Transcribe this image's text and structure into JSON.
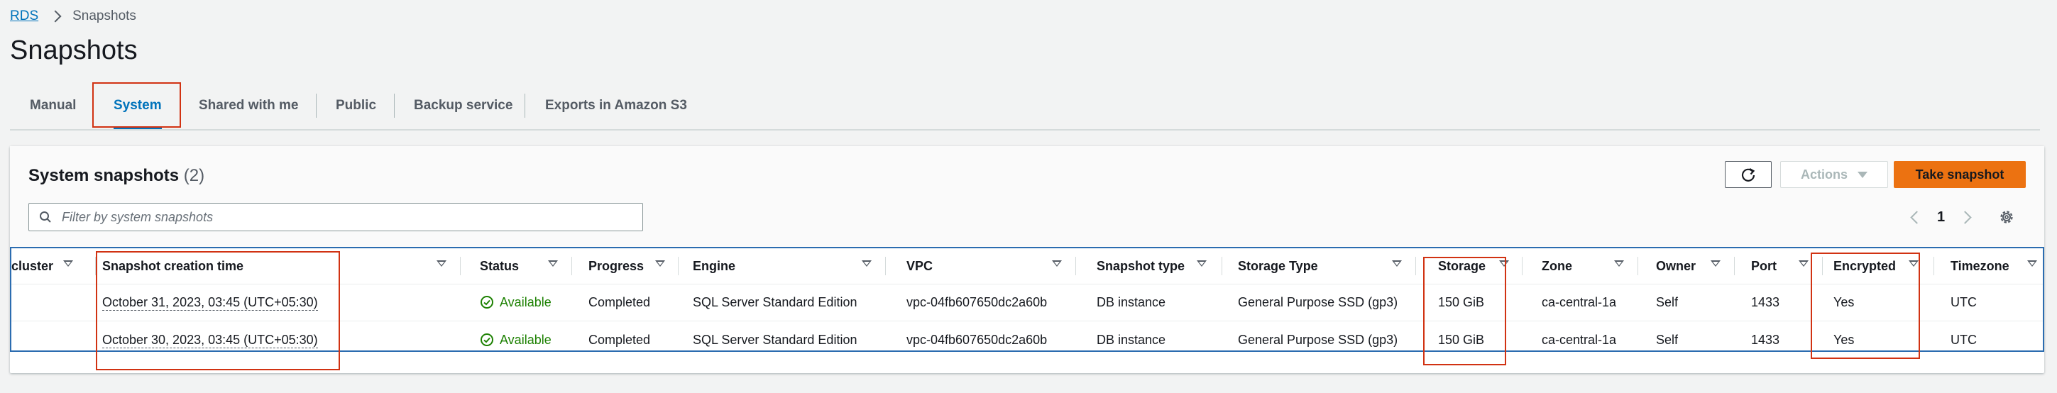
{
  "breadcrumb": {
    "root": "RDS",
    "current": "Snapshots"
  },
  "page_title": "Snapshots",
  "tabs": [
    {
      "label": "Manual",
      "active": false
    },
    {
      "label": "System",
      "active": true
    },
    {
      "label": "Shared with me",
      "active": false
    },
    {
      "label": "Public",
      "active": false
    },
    {
      "label": "Backup service",
      "active": false
    },
    {
      "label": "Exports in Amazon S3",
      "active": false
    }
  ],
  "panel": {
    "title": "System snapshots",
    "count": "(2)",
    "actions_label": "Actions",
    "take_snapshot_label": "Take snapshot",
    "search_placeholder": "Filter by system snapshots",
    "page": "1"
  },
  "table": {
    "columns": [
      "cluster",
      "Snapshot creation time",
      "Status",
      "Progress",
      "Engine",
      "VPC",
      "Snapshot type",
      "Storage Type",
      "Storage",
      "Zone",
      "Owner",
      "Port",
      "Encrypted",
      "Timezone"
    ],
    "rows": [
      {
        "cluster": "",
        "creation_time": "October 31, 2023, 03:45 (UTC+05:30)",
        "status": "Available",
        "progress": "Completed",
        "engine": "SQL Server Standard Edition",
        "vpc": "vpc-04fb607650dc2a60b",
        "snapshot_type": "DB instance",
        "storage_type": "General Purpose SSD (gp3)",
        "storage": "150 GiB",
        "zone": "ca-central-1a",
        "owner": "Self",
        "port": "1433",
        "encrypted": "Yes",
        "timezone": "UTC"
      },
      {
        "cluster": "",
        "creation_time": "October 30, 2023, 03:45 (UTC+05:30)",
        "status": "Available",
        "progress": "Completed",
        "engine": "SQL Server Standard Edition",
        "vpc": "vpc-04fb607650dc2a60b",
        "snapshot_type": "DB instance",
        "storage_type": "General Purpose SSD (gp3)",
        "storage": "150 GiB",
        "zone": "ca-central-1a",
        "owner": "Self",
        "port": "1433",
        "encrypted": "Yes",
        "timezone": "UTC"
      }
    ]
  },
  "colors": {
    "link": "#0073bb",
    "primary_button": "#ec7211",
    "success": "#1d8102",
    "highlight": "#d13212"
  },
  "icons": [
    "refresh-icon",
    "search-icon",
    "chevron-left-icon",
    "chevron-right-icon",
    "gear-icon",
    "status-check-icon",
    "sort-caret-icon"
  ]
}
